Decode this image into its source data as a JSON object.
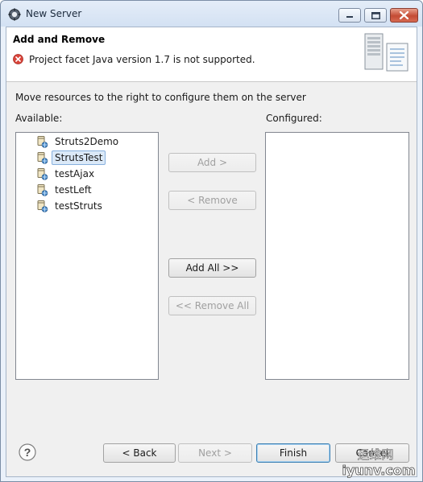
{
  "window": {
    "title": "New Server",
    "icons": {
      "app": "gear-icon",
      "minimize": "minimize-icon",
      "maximize": "maximize-icon",
      "close": "close-icon"
    }
  },
  "header": {
    "title": "Add and Remove",
    "message": "Project facet Java version 1.7 is not supported.",
    "message_icon": "error-icon",
    "graphic": "server-wizard-icon"
  },
  "instructions": "Move resources to the right to configure them on the server",
  "available": {
    "label": "Available:",
    "items": [
      {
        "label": "Struts2Demo",
        "icon": "web-project-icon",
        "selected": false
      },
      {
        "label": "StrutsTest",
        "icon": "web-project-icon",
        "selected": true
      },
      {
        "label": "testAjax",
        "icon": "web-project-icon",
        "selected": false
      },
      {
        "label": "testLeft",
        "icon": "web-project-icon",
        "selected": false
      },
      {
        "label": "testStruts",
        "icon": "web-project-icon",
        "selected": false
      }
    ]
  },
  "configured": {
    "label": "Configured:",
    "items": []
  },
  "transfer_buttons": {
    "add": "Add >",
    "remove": "< Remove",
    "add_all": "Add All >>",
    "remove_all": "<< Remove All"
  },
  "footer": {
    "help_icon": "help-icon",
    "back": "< Back",
    "next": "Next >",
    "finish": "Finish",
    "cancel": "Cancel"
  },
  "watermark": {
    "line1": "运维网",
    "line2": "iyunv.com"
  },
  "colors": {
    "accent": "#3c7fb1",
    "selection": "#dbe9f8",
    "error": "#d9443a",
    "disabled_text": "#a0a0a0"
  }
}
